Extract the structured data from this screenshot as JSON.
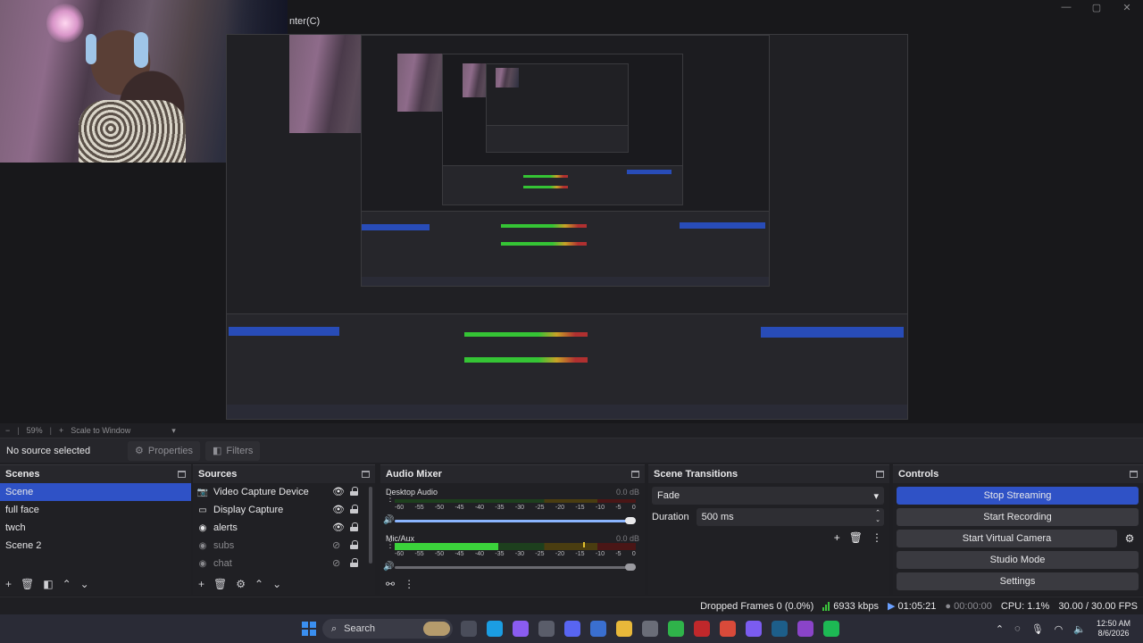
{
  "preview": {
    "title_fragment": "nter(C)",
    "window_controls": [
      "—",
      "▢",
      "✕"
    ]
  },
  "zoom_bar": {
    "zoom_minus": "−",
    "zoom_value": "59%",
    "zoom_plus": "+",
    "scale_mode": "Scale to Window"
  },
  "source_toolbar": {
    "status": "No source selected",
    "properties_label": "Properties",
    "filters_label": "Filters"
  },
  "scenes": {
    "title": "Scenes",
    "items": [
      {
        "label": "Scene",
        "active": true
      },
      {
        "label": "full face",
        "active": false
      },
      {
        "label": "twch",
        "active": false
      },
      {
        "label": "Scene 2",
        "active": false
      }
    ]
  },
  "sources": {
    "title": "Sources",
    "items": [
      {
        "label": "Video Capture Device",
        "icon": "camera-icon",
        "visible": true
      },
      {
        "label": "Display Capture",
        "icon": "monitor-icon",
        "visible": true
      },
      {
        "label": "alerts",
        "icon": "globe-icon",
        "visible": true
      },
      {
        "label": "subs",
        "icon": "globe-icon",
        "visible": false
      },
      {
        "label": "chat",
        "icon": "globe-icon",
        "visible": false
      }
    ]
  },
  "audio_mixer": {
    "title": "Audio Mixer",
    "ticks": [
      "-60",
      "-55",
      "-50",
      "-45",
      "-40",
      "-35",
      "-30",
      "-25",
      "-20",
      "-15",
      "-10",
      "-5",
      "0"
    ],
    "channels": [
      {
        "name": "Desktop Audio",
        "db": "0.0 dB",
        "level": 0.0,
        "volume": 1.0,
        "muted": false
      },
      {
        "name": "Mic/Aux",
        "db": "0.0 dB",
        "level": 0.43,
        "peak": 0.78,
        "volume": 1.0,
        "muted": true
      }
    ]
  },
  "transitions": {
    "title": "Scene Transitions",
    "selected": "Fade",
    "duration_label": "Duration",
    "duration_value": "500 ms"
  },
  "controls": {
    "title": "Controls",
    "stop_streaming": "Stop Streaming",
    "start_recording": "Start Recording",
    "start_virtual_camera": "Start Virtual Camera",
    "studio_mode": "Studio Mode",
    "settings": "Settings"
  },
  "status_bar": {
    "dropped_frames": "Dropped Frames 0 (0.0%)",
    "bitrate": "6933 kbps",
    "stream_time": "01:05:21",
    "record_time": "00:00:00",
    "cpu": "CPU: 1.1%",
    "fps": "30.00 / 30.00 FPS"
  },
  "taskbar": {
    "search_label": "Search",
    "clock_time": "12:50 AM",
    "clock_date": "8/6/2026",
    "apps": [
      {
        "name": "file-explorer-icon",
        "color": "#4a4d5a"
      },
      {
        "name": "edge-icon",
        "color": "#1b9de2"
      },
      {
        "name": "copilot-icon",
        "color": "#8a5cf0"
      },
      {
        "name": "app-icon",
        "color": "#5a5d6a"
      },
      {
        "name": "discord-icon",
        "color": "#5865f2"
      },
      {
        "name": "store-icon",
        "color": "#3a6fd0"
      },
      {
        "name": "folder-icon",
        "color": "#e8b83a"
      },
      {
        "name": "app-icon",
        "color": "#6a6d78"
      },
      {
        "name": "xbox-icon",
        "color": "#2fb34a"
      },
      {
        "name": "obs-icon",
        "color": "#c0282b"
      },
      {
        "name": "chrome-icon",
        "color": "#d94a3a"
      },
      {
        "name": "messenger-icon",
        "color": "#7b5cf0"
      },
      {
        "name": "steam-icon",
        "color": "#1d5e8a"
      },
      {
        "name": "app-icon",
        "color": "#8a44c8"
      },
      {
        "name": "spotify-icon",
        "color": "#1db954"
      }
    ]
  }
}
